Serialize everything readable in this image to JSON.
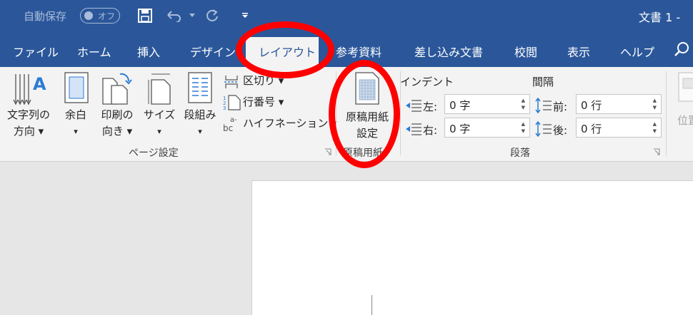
{
  "titlebar": {
    "autosave_label": "自動保存",
    "autosave_state": "オフ",
    "doc_title": "文書 1 -",
    "bg_color": "#2b579a"
  },
  "quick_access": {
    "save_icon": "save-icon",
    "undo_icon": "undo-icon",
    "redo_icon": "redo-icon",
    "customize_icon": "customize-qat-icon"
  },
  "tabs": [
    {
      "label": "ファイル"
    },
    {
      "label": "ホーム"
    },
    {
      "label": "挿入"
    },
    {
      "label": "デザイン"
    },
    {
      "label": "レイアウト",
      "active": true
    },
    {
      "label": "参考資料"
    },
    {
      "label": "差し込み文書"
    },
    {
      "label": "校閲"
    },
    {
      "label": "表示"
    },
    {
      "label": "ヘルプ"
    }
  ],
  "page_setup": {
    "text_direction": [
      "文字列の",
      "方向 ▾"
    ],
    "margins": [
      "余白",
      "▾"
    ],
    "orientation": [
      "印刷の",
      "向き ▾"
    ],
    "size": [
      "サイズ",
      "▾"
    ],
    "columns": [
      "段組み",
      "▾"
    ],
    "breaks": "区切り ▾",
    "line_numbers": "行番号 ▾",
    "hyphenation": "ハイフネーション ▾",
    "group_label": "ページ設定"
  },
  "genko": {
    "button": [
      "原稿用紙",
      "設定"
    ],
    "group_label": "原稿用紙"
  },
  "paragraph": {
    "indent_title": "インデント",
    "left_label": "左:",
    "left_value": "0 字",
    "right_label": "右:",
    "right_value": "0 字",
    "spacing_title": "間隔",
    "before_label": "前:",
    "before_value": "0 行",
    "after_label": "後:",
    "after_value": "0 行",
    "group_label": "段落"
  },
  "arrange": {
    "position_label": "位置"
  },
  "colors": {
    "accent": "#2b579a",
    "annotation": "#ff0000"
  }
}
